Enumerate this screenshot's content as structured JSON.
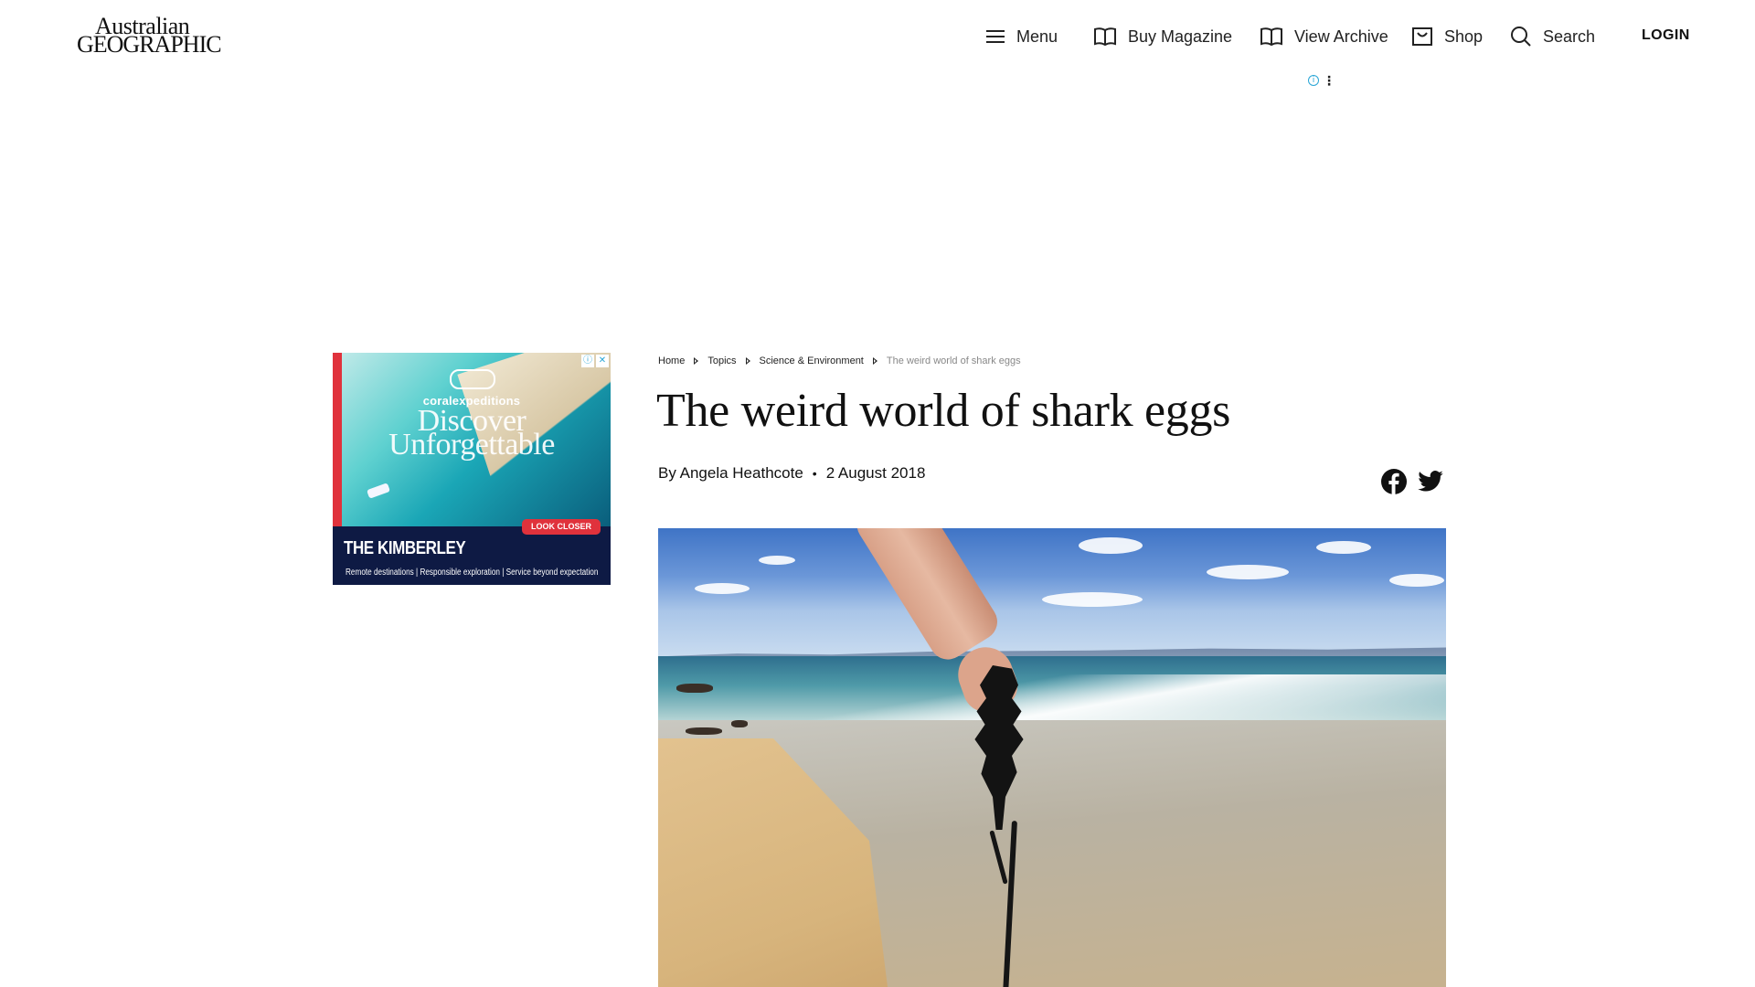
{
  "header": {
    "logo": {
      "line1": "Australian",
      "line2": "GEOGRAPHIC"
    },
    "nav": {
      "menu": "Menu",
      "buy_magazine": "Buy Magazine",
      "view_archive": "View Archive",
      "shop": "Shop",
      "search": "Search",
      "login": "LOGIN"
    }
  },
  "ad_side": {
    "brand": "coralexpeditions",
    "headline_line1": "Discover",
    "headline_line2": "Unforgettable",
    "cta": "LOOK CLOSER",
    "title": "THE KIMBERLEY",
    "subtitle": "Remote destinations | Responsible exploration | Service beyond expectation"
  },
  "article": {
    "breadcrumb": [
      "Home",
      "Topics",
      "Science & Environment",
      "The weird world of shark eggs"
    ],
    "title": "The weird world of shark eggs",
    "author": "By Angela Heathcote",
    "date": "2 August 2018"
  },
  "icons": {
    "menu": "hamburger-icon",
    "buy_magazine": "open-book-icon",
    "view_archive": "open-book-icon",
    "shop": "shopping-bag-icon",
    "search": "search-icon",
    "facebook": "facebook-icon",
    "twitter": "twitter-icon"
  }
}
